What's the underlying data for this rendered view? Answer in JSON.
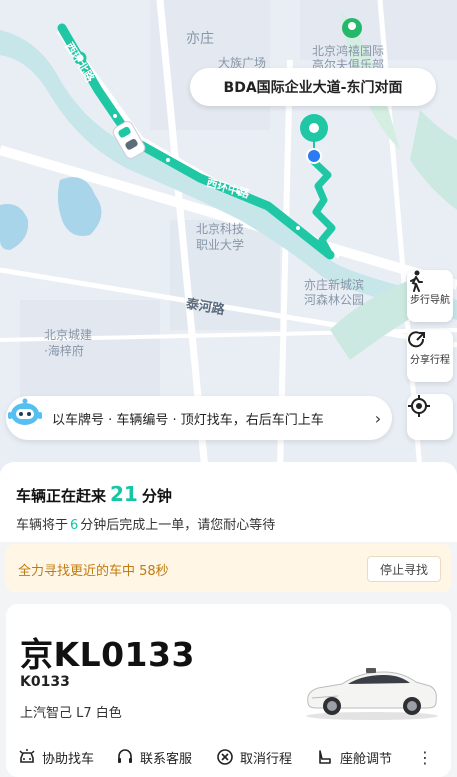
{
  "map": {
    "labels": {
      "yizhuang": "亦庄",
      "daze": "大族广场",
      "hongtai": "北京鸿禧国际",
      "hongtai2": "高尔夫俱乐部",
      "kejizhiye": "北京科技",
      "kejizhiye2": "职业大学",
      "yizhuang_park": "亦庄新城滨",
      "yizhuang_park2": "河森林公园",
      "jianchuang": "北京城建",
      "jianchuang2": "·海梓府"
    },
    "roads": {
      "road1": "西环北路",
      "road2": "西环中路",
      "road3": "泰河路"
    },
    "destination": "BDA国际企业大道-东门对面"
  },
  "side_buttons": {
    "walk_nav": "步行导航",
    "share_trip": "分享行程"
  },
  "tip": {
    "text": "以车牌号 · 车辆编号 · 顶灯找车，右后车门上车"
  },
  "status": {
    "line1_prefix": "车辆正在赶来",
    "minutes": "21",
    "line1_suffix": "分钟",
    "line2_prefix": "车辆将于",
    "minutes2": "6",
    "line2_suffix": "分钟后完成上一单，请您耐心等待"
  },
  "search": {
    "text": "全力寻找更近的车中 58秒",
    "stop_label": "停止寻找"
  },
  "vehicle": {
    "plate": "京KL0133",
    "vehicle_id": "K0133",
    "model": "上汽智己 L7 白色"
  },
  "actions": {
    "find_car": "协助找车",
    "contact": "联系客服",
    "cancel": "取消行程",
    "seat": "座舱调节"
  },
  "colors": {
    "accent": "#13c6a5",
    "route": "#1fc7a5",
    "warning": "#c07a10"
  }
}
